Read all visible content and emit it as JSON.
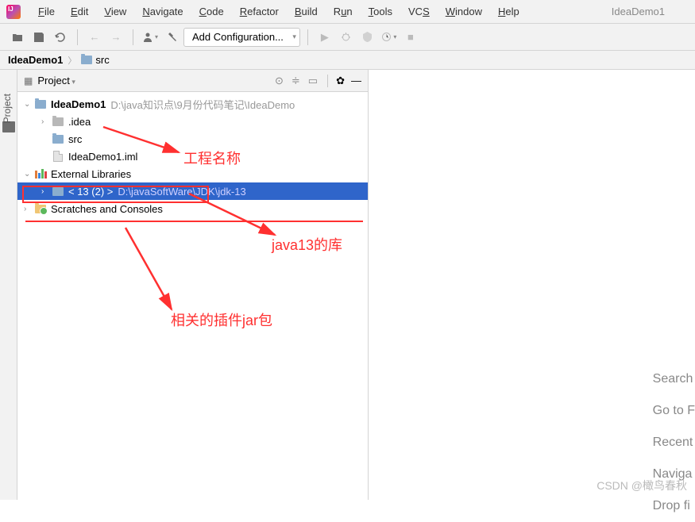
{
  "menubar": {
    "items": [
      "File",
      "Edit",
      "View",
      "Navigate",
      "Code",
      "Refactor",
      "Build",
      "Run",
      "Tools",
      "VCS",
      "Window",
      "Help"
    ],
    "project_name": "IdeaDemo1"
  },
  "toolbar": {
    "config_label": "Add Configuration..."
  },
  "breadcrumb": {
    "root": "IdeaDemo1",
    "child": "src"
  },
  "side_tab": {
    "label": "Project"
  },
  "panel": {
    "title": "Project"
  },
  "tree": {
    "root": {
      "name": "IdeaDemo1",
      "path": "D:\\java知识点\\9月份代码笔记\\IdeaDemo"
    },
    "idea_folder": ".idea",
    "src_folder": "src",
    "iml_file": "IdeaDemo1.iml",
    "external_libs": "External Libraries",
    "jdk": {
      "name": "< 13 (2) >",
      "path": "D:\\javaSoftWare\\JDK\\jdk-13"
    },
    "scratches": "Scratches and Consoles"
  },
  "editor_hints": {
    "search": "Search",
    "goto": "Go to F",
    "recent": "Recent",
    "nav": "Naviga",
    "drop": "Drop fi"
  },
  "annotations": {
    "project_name": "工程名称",
    "java_lib": "java13的库",
    "jar_plugins": "相关的插件jar包"
  },
  "watermark": "CSDN @橄鸟春秋"
}
